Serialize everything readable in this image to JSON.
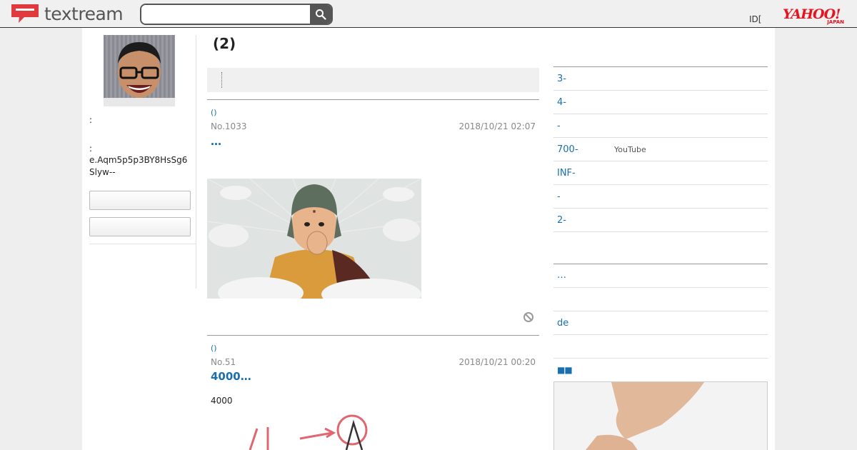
{
  "header": {
    "logo_text": "textream",
    "search_placeholder": "",
    "id_text": "ID[",
    "yahoo_main": "YAHOO!",
    "yahoo_sub": "JAPAN"
  },
  "left": {
    "label1": ":",
    "label2": ":",
    "user_id": "e.Aqm5p5p3BY8HsSg6Slyw--",
    "button1": "",
    "button2": ""
  },
  "main": {
    "title": "(2)",
    "posts": [
      {
        "small": "()",
        "no": "No.1033",
        "date": "2018/10/21 02:07",
        "title": "…",
        "body": ""
      },
      {
        "small": "()",
        "no": "No.51",
        "date": "2018/10/21 00:20",
        "title": "4000…",
        "body": "4000"
      }
    ]
  },
  "right": {
    "rows": [
      {
        "label": "3-",
        "tag": ""
      },
      {
        "label": " 4-",
        "tag": ""
      },
      {
        "label": " -",
        "tag": ""
      },
      {
        "label": "700-",
        "tag": "YouTube"
      },
      {
        "label": " INF-",
        "tag": ""
      },
      {
        "label": " -",
        "tag": ""
      },
      {
        "label": "2-",
        "tag": ""
      }
    ],
    "section2": [
      {
        "label": "…"
      },
      {
        "label": ""
      },
      {
        "label": "de"
      },
      {
        "label": ""
      }
    ],
    "squares": "■■"
  },
  "colors": {
    "link": "#1a6fb0",
    "logo_red": "#e0393e",
    "yahoo_red": "#e5141e"
  }
}
